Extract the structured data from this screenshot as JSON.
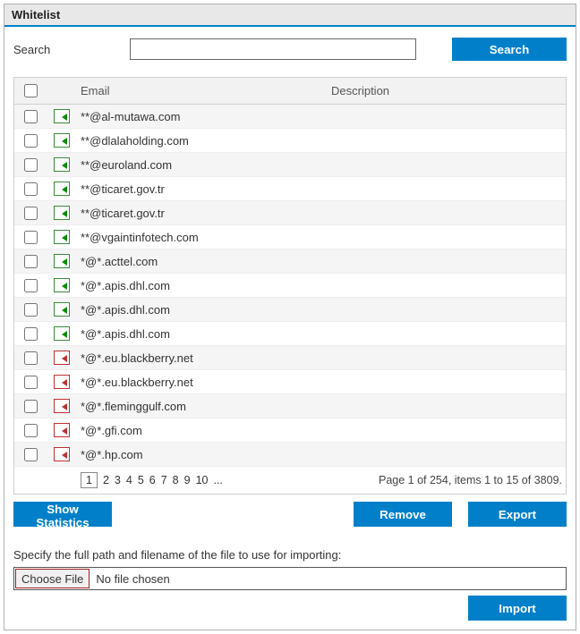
{
  "header": {
    "title": "Whitelist"
  },
  "search": {
    "label": "Search",
    "value": "",
    "button": "Search"
  },
  "table": {
    "columns": {
      "email": "Email",
      "description": "Description"
    },
    "rows": [
      {
        "email": "**@al-mutawa.com",
        "desc": "",
        "iconVariant": "green"
      },
      {
        "email": "**@dlalaholding.com",
        "desc": "",
        "iconVariant": "green"
      },
      {
        "email": "**@euroland.com",
        "desc": "",
        "iconVariant": "green"
      },
      {
        "email": "**@ticaret.gov.tr",
        "desc": "",
        "iconVariant": "green"
      },
      {
        "email": "**@ticaret.gov.tr",
        "desc": "",
        "iconVariant": "green"
      },
      {
        "email": "**@vgaintinfotech.com",
        "desc": "",
        "iconVariant": "green"
      },
      {
        "email": "*@*.acttel.com",
        "desc": "",
        "iconVariant": "green"
      },
      {
        "email": "*@*.apis.dhl.com",
        "desc": "",
        "iconVariant": "green"
      },
      {
        "email": "*@*.apis.dhl.com",
        "desc": "",
        "iconVariant": "green"
      },
      {
        "email": "*@*.apis.dhl.com",
        "desc": "",
        "iconVariant": "green"
      },
      {
        "email": "*@*.eu.blackberry.net",
        "desc": "",
        "iconVariant": "red"
      },
      {
        "email": "*@*.eu.blackberry.net",
        "desc": "",
        "iconVariant": "red"
      },
      {
        "email": "*@*.fleminggulf.com",
        "desc": "",
        "iconVariant": "red"
      },
      {
        "email": "*@*.gfi.com",
        "desc": "",
        "iconVariant": "red"
      },
      {
        "email": "*@*.hp.com",
        "desc": "",
        "iconVariant": "red"
      }
    ]
  },
  "pager": {
    "pages": [
      "1",
      "2",
      "3",
      "4",
      "5",
      "6",
      "7",
      "8",
      "9",
      "10",
      "..."
    ],
    "current": "1",
    "info": "Page 1 of 254, items 1 to 15 of 3809."
  },
  "actions": {
    "stats": "Show Statistics",
    "remove": "Remove",
    "export": "Export"
  },
  "import": {
    "label": "Specify the full path and filename of the file to use for importing:",
    "chooseFile": "Choose File",
    "noFile": "No file chosen",
    "button": "Import"
  }
}
